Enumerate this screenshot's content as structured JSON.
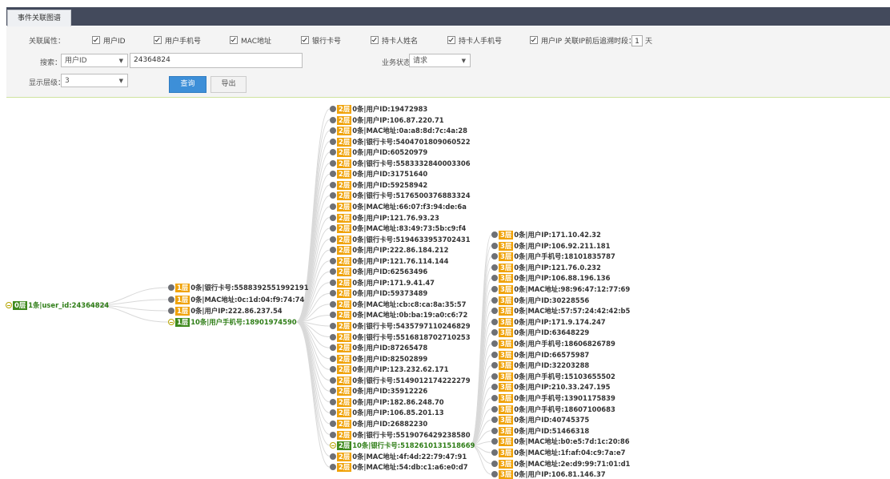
{
  "tab": {
    "label": "事件关联图谱"
  },
  "filters": {
    "assoc_label": "关联属性：",
    "checkboxes": [
      "用户ID",
      "用户手机号",
      "MAC地址",
      "银行卡号",
      "持卡人姓名",
      "持卡人手机号",
      "用户IP 关联IP前后追溯时段："
    ],
    "days_value": "1",
    "days_unit": "天",
    "search_label": "搜索：",
    "search_type": "用户ID",
    "search_value": "24364824",
    "status_label": "业务状态：",
    "status_value": "请求",
    "level_label": "显示层级：",
    "level_value": "3",
    "query_button": "查询",
    "export_button": "导出"
  },
  "root": {
    "badge": "0层",
    "text": "1条|user_id:24364824"
  },
  "level1": [
    {
      "badge": "1层",
      "text": "0条|银行卡号:5588392551992191",
      "expanded": false
    },
    {
      "badge": "1层",
      "text": "0条|MAC地址:0c:1d:04:f9:74:74",
      "expanded": false
    },
    {
      "badge": "1层",
      "text": "0条|用户IP:222.86.237.54",
      "expanded": false
    },
    {
      "badge": "1层",
      "text": "10条|用户手机号:18901974590",
      "expanded": true
    }
  ],
  "level2": [
    {
      "badge": "2层",
      "text": "0条|用户ID:19472983"
    },
    {
      "badge": "2层",
      "text": "0条|用户IP:106.87.220.71"
    },
    {
      "badge": "2层",
      "text": "0条|MAC地址:0a:a8:8d:7c:4a:28"
    },
    {
      "badge": "2层",
      "text": "0条|银行卡号:5404701809060522"
    },
    {
      "badge": "2层",
      "text": "0条|用户ID:60520979"
    },
    {
      "badge": "2层",
      "text": "0条|银行卡号:5583332840003306"
    },
    {
      "badge": "2层",
      "text": "0条|用户ID:31751640"
    },
    {
      "badge": "2层",
      "text": "0条|用户ID:59258942"
    },
    {
      "badge": "2层",
      "text": "0条|银行卡号:5176500376883324"
    },
    {
      "badge": "2层",
      "text": "0条|MAC地址:66:07:f3:94:de:6a"
    },
    {
      "badge": "2层",
      "text": "0条|用户IP:121.76.93.23"
    },
    {
      "badge": "2层",
      "text": "0条|MAC地址:83:49:73:5b:c9:f4"
    },
    {
      "badge": "2层",
      "text": "0条|银行卡号:5194633953702431"
    },
    {
      "badge": "2层",
      "text": "0条|用户IP:222.86.184.212"
    },
    {
      "badge": "2层",
      "text": "0条|用户IP:121.76.114.144"
    },
    {
      "badge": "2层",
      "text": "0条|用户ID:62563496"
    },
    {
      "badge": "2层",
      "text": "0条|用户IP:171.9.41.47"
    },
    {
      "badge": "2层",
      "text": "0条|用户ID:59373489"
    },
    {
      "badge": "2层",
      "text": "0条|MAC地址:cb:c8:ca:8a:35:57"
    },
    {
      "badge": "2层",
      "text": "0条|MAC地址:0b:ba:19:a0:c6:72"
    },
    {
      "badge": "2层",
      "text": "0条|银行卡号:5435797110246829"
    },
    {
      "badge": "2层",
      "text": "0条|银行卡号:5516818702710253"
    },
    {
      "badge": "2层",
      "text": "0条|用户ID:87265478"
    },
    {
      "badge": "2层",
      "text": "0条|用户ID:82502899"
    },
    {
      "badge": "2层",
      "text": "0条|用户IP:123.232.62.171"
    },
    {
      "badge": "2层",
      "text": "0条|银行卡号:5149012174222279"
    },
    {
      "badge": "2层",
      "text": "0条|用户ID:35912226"
    },
    {
      "badge": "2层",
      "text": "0条|用户IP:182.86.248.70"
    },
    {
      "badge": "2层",
      "text": "0条|用户IP:106.85.201.13"
    },
    {
      "badge": "2层",
      "text": "0条|用户ID:26882230"
    },
    {
      "badge": "2层",
      "text": "0条|银行卡号:5519076429238580"
    },
    {
      "badge": "2层",
      "text": "10条|银行卡号:5182610131518669",
      "expanded": true
    },
    {
      "badge": "2层",
      "text": "0条|MAC地址:4f:4d:22:79:47:91"
    },
    {
      "badge": "2层",
      "text": "0条|MAC地址:54:db:c1:a6:e0:d7"
    }
  ],
  "level3": [
    {
      "badge": "3层",
      "text": "0条|用户IP:171.10.42.32"
    },
    {
      "badge": "3层",
      "text": "0条|用户IP:106.92.211.181"
    },
    {
      "badge": "3层",
      "text": "0条|用户手机号:18101835787"
    },
    {
      "badge": "3层",
      "text": "0条|用户IP:121.76.0.232"
    },
    {
      "badge": "3层",
      "text": "0条|用户IP:106.88.196.136"
    },
    {
      "badge": "3层",
      "text": "0条|MAC地址:98:96:47:12:77:69"
    },
    {
      "badge": "3层",
      "text": "0条|用户ID:30228556"
    },
    {
      "badge": "3层",
      "text": "0条|MAC地址:57:57:24:42:42:b5"
    },
    {
      "badge": "3层",
      "text": "0条|用户IP:171.9.174.247"
    },
    {
      "badge": "3层",
      "text": "0条|用户ID:63648229"
    },
    {
      "badge": "3层",
      "text": "0条|用户手机号:18606826789"
    },
    {
      "badge": "3层",
      "text": "0条|用户ID:66575987"
    },
    {
      "badge": "3层",
      "text": "0条|用户ID:32203288"
    },
    {
      "badge": "3层",
      "text": "0条|用户手机号:15103655502"
    },
    {
      "badge": "3层",
      "text": "0条|用户IP:210.33.247.195"
    },
    {
      "badge": "3层",
      "text": "0条|用户手机号:13901175839"
    },
    {
      "badge": "3层",
      "text": "0条|用户手机号:18607100683"
    },
    {
      "badge": "3层",
      "text": "0条|用户ID:40745375"
    },
    {
      "badge": "3层",
      "text": "0条|用户ID:51466318"
    },
    {
      "badge": "3层",
      "text": "0条|MAC地址:b0:e5:7d:1c:20:86"
    },
    {
      "badge": "3层",
      "text": "0条|MAC地址:1f:af:04:c9:7a:e7"
    },
    {
      "badge": "3层",
      "text": "0条|MAC地址:2e:d9:99:71:01:d1"
    },
    {
      "badge": "3层",
      "text": "0条|用户IP:106.81.146.37"
    }
  ],
  "colors": {
    "badge": "#f0a30a",
    "root_badge": "#3f8a1e",
    "highlight": "#2e7d16",
    "link": "#d9d9d9",
    "query_button": "#3d8fd8"
  }
}
